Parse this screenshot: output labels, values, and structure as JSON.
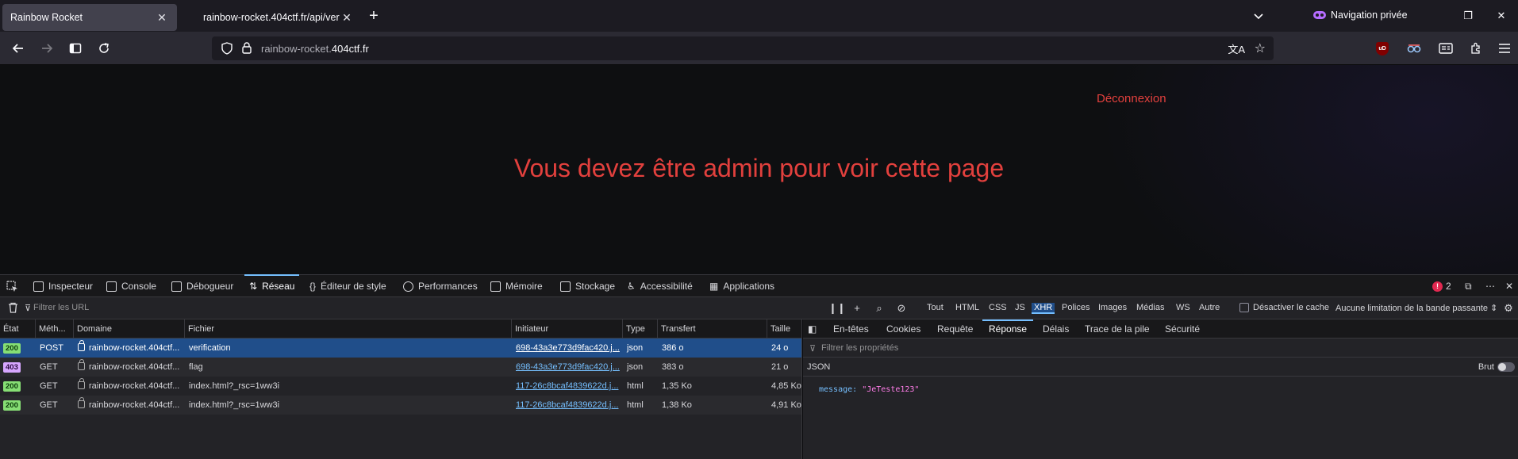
{
  "tabs": [
    {
      "title": "Rainbow Rocket",
      "active": true
    },
    {
      "title": "rainbow-rocket.404ctf.fr/api/ver",
      "active": false
    }
  ],
  "private_label": "Navigation privée",
  "url": {
    "prefix": "rainbow-rocket.",
    "domain": "404ctf.fr"
  },
  "extensions": {
    "ublock_label": "uD"
  },
  "page": {
    "logout": "Déconnexion",
    "message": "Vous devez être admin pour voir cette page"
  },
  "devtools": {
    "tabs": [
      "Inspecteur",
      "Console",
      "Débogueur",
      "Réseau",
      "Éditeur de style",
      "Performances",
      "Mémoire",
      "Stockage",
      "Accessibilité",
      "Applications"
    ],
    "active_tab": "Réseau",
    "error_count": "2",
    "filter_placeholder": "Filtrer les URL",
    "type_filters": [
      "Tout",
      "HTML",
      "CSS",
      "JS",
      "XHR",
      "Polices",
      "Images",
      "Médias",
      "WS",
      "Autre"
    ],
    "active_type": "XHR",
    "disable_cache": "Désactiver le cache",
    "throttle": "Aucune limitation de la bande passante",
    "columns": [
      "État",
      "Méth...",
      "Domaine",
      "Fichier",
      "Initiateur",
      "Type",
      "Transfert",
      "Taille"
    ],
    "requests": [
      {
        "status": "200",
        "method": "POST",
        "domain": "rainbow-rocket.404ctf...",
        "file": "verification",
        "initiator": "698-43a3e773d9fac420.j...",
        "type": "json",
        "transfer": "386 o",
        "size": "24 o",
        "selected": true
      },
      {
        "status": "403",
        "method": "GET",
        "domain": "rainbow-rocket.404ctf...",
        "file": "flag",
        "initiator": "698-43a3e773d9fac420.j...",
        "type": "json",
        "transfer": "383 o",
        "size": "21 o",
        "selected": false
      },
      {
        "status": "200",
        "method": "GET",
        "domain": "rainbow-rocket.404ctf...",
        "file": "index.html?_rsc=1ww3i",
        "initiator": "117-26c8bcaf4839622d.j...",
        "type": "html",
        "transfer": "1,35 Ko",
        "size": "4,85 Ko",
        "selected": false
      },
      {
        "status": "200",
        "method": "GET",
        "domain": "rainbow-rocket.404ctf...",
        "file": "index.html?_rsc=1ww3i",
        "initiator": "117-26c8bcaf4839622d.j...",
        "type": "html",
        "transfer": "1,38 Ko",
        "size": "4,91 Ko",
        "selected": false
      }
    ],
    "side_tabs": [
      "En-têtes",
      "Cookies",
      "Requête",
      "Réponse",
      "Délais",
      "Trace de la pile",
      "Sécurité"
    ],
    "active_side_tab": "Réponse",
    "props_filter": "Filtrer les propriétés",
    "json_label": "JSON",
    "raw_label": "Brut",
    "response": {
      "key": "message:",
      "value": "\"JeTeste123\""
    }
  },
  "colors": {
    "accent": "#75bfff",
    "error_text": "#e2403d",
    "selected_row": "#204e8a"
  }
}
